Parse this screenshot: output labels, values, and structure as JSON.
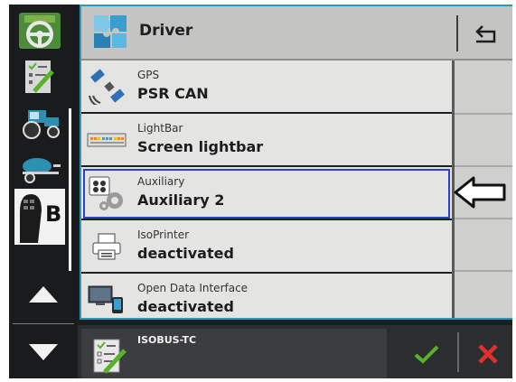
{
  "header": {
    "title": "Driver"
  },
  "rows": [
    {
      "label": "GPS",
      "value": "PSR CAN",
      "icon": "satellite-icon"
    },
    {
      "label": "LightBar",
      "value": "Screen lightbar",
      "icon": "lightbar-icon"
    },
    {
      "label": "Auxiliary",
      "value": "Auxiliary 2",
      "icon": "auxiliary-icon",
      "selected": true
    },
    {
      "label": "IsoPrinter",
      "value": "deactivated",
      "icon": "printer-icon"
    },
    {
      "label": "Open Data Interface",
      "value": "deactivated",
      "icon": "data-interface-icon"
    }
  ],
  "sidebar": {
    "items": [
      {
        "icon": "steering-wheel-icon"
      },
      {
        "icon": "task-list-icon"
      },
      {
        "icon": "tractor-icon"
      },
      {
        "icon": "sprayer-icon"
      },
      {
        "icon": "joystick-b-icon",
        "selected": true,
        "letter": "B"
      }
    ]
  },
  "bottom": {
    "app_label": "ISOBUS-TC"
  },
  "colors": {
    "accent": "#2c99b7",
    "selection": "#2a3fd3",
    "ok": "#58b22a",
    "cancel": "#e0302b"
  }
}
